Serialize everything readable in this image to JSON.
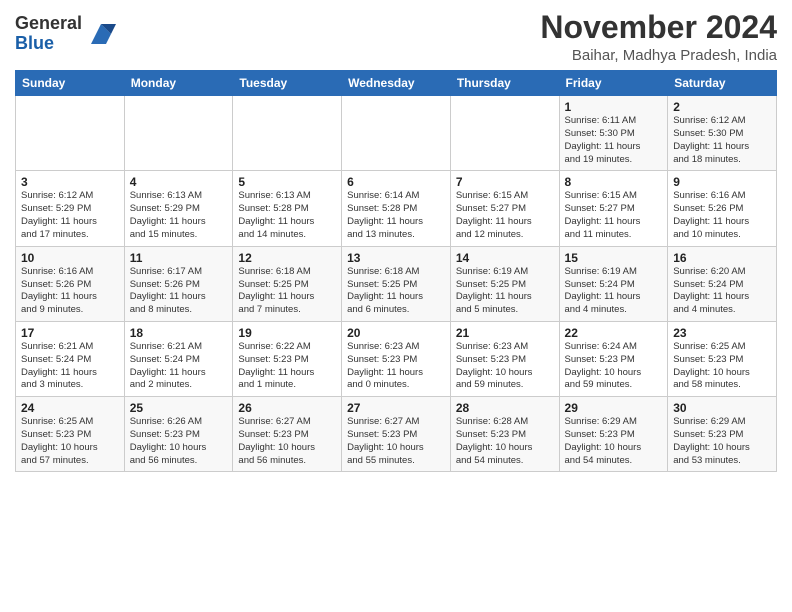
{
  "header": {
    "logo": {
      "line1": "General",
      "line2": "Blue"
    },
    "title": "November 2024",
    "location": "Baihar, Madhya Pradesh, India"
  },
  "calendar": {
    "weekdays": [
      "Sunday",
      "Monday",
      "Tuesday",
      "Wednesday",
      "Thursday",
      "Friday",
      "Saturday"
    ],
    "weeks": [
      [
        {
          "day": "",
          "detail": ""
        },
        {
          "day": "",
          "detail": ""
        },
        {
          "day": "",
          "detail": ""
        },
        {
          "day": "",
          "detail": ""
        },
        {
          "day": "",
          "detail": ""
        },
        {
          "day": "1",
          "detail": "Sunrise: 6:11 AM\nSunset: 5:30 PM\nDaylight: 11 hours\nand 19 minutes."
        },
        {
          "day": "2",
          "detail": "Sunrise: 6:12 AM\nSunset: 5:30 PM\nDaylight: 11 hours\nand 18 minutes."
        }
      ],
      [
        {
          "day": "3",
          "detail": "Sunrise: 6:12 AM\nSunset: 5:29 PM\nDaylight: 11 hours\nand 17 minutes."
        },
        {
          "day": "4",
          "detail": "Sunrise: 6:13 AM\nSunset: 5:29 PM\nDaylight: 11 hours\nand 15 minutes."
        },
        {
          "day": "5",
          "detail": "Sunrise: 6:13 AM\nSunset: 5:28 PM\nDaylight: 11 hours\nand 14 minutes."
        },
        {
          "day": "6",
          "detail": "Sunrise: 6:14 AM\nSunset: 5:28 PM\nDaylight: 11 hours\nand 13 minutes."
        },
        {
          "day": "7",
          "detail": "Sunrise: 6:15 AM\nSunset: 5:27 PM\nDaylight: 11 hours\nand 12 minutes."
        },
        {
          "day": "8",
          "detail": "Sunrise: 6:15 AM\nSunset: 5:27 PM\nDaylight: 11 hours\nand 11 minutes."
        },
        {
          "day": "9",
          "detail": "Sunrise: 6:16 AM\nSunset: 5:26 PM\nDaylight: 11 hours\nand 10 minutes."
        }
      ],
      [
        {
          "day": "10",
          "detail": "Sunrise: 6:16 AM\nSunset: 5:26 PM\nDaylight: 11 hours\nand 9 minutes."
        },
        {
          "day": "11",
          "detail": "Sunrise: 6:17 AM\nSunset: 5:26 PM\nDaylight: 11 hours\nand 8 minutes."
        },
        {
          "day": "12",
          "detail": "Sunrise: 6:18 AM\nSunset: 5:25 PM\nDaylight: 11 hours\nand 7 minutes."
        },
        {
          "day": "13",
          "detail": "Sunrise: 6:18 AM\nSunset: 5:25 PM\nDaylight: 11 hours\nand 6 minutes."
        },
        {
          "day": "14",
          "detail": "Sunrise: 6:19 AM\nSunset: 5:25 PM\nDaylight: 11 hours\nand 5 minutes."
        },
        {
          "day": "15",
          "detail": "Sunrise: 6:19 AM\nSunset: 5:24 PM\nDaylight: 11 hours\nand 4 minutes."
        },
        {
          "day": "16",
          "detail": "Sunrise: 6:20 AM\nSunset: 5:24 PM\nDaylight: 11 hours\nand 4 minutes."
        }
      ],
      [
        {
          "day": "17",
          "detail": "Sunrise: 6:21 AM\nSunset: 5:24 PM\nDaylight: 11 hours\nand 3 minutes."
        },
        {
          "day": "18",
          "detail": "Sunrise: 6:21 AM\nSunset: 5:24 PM\nDaylight: 11 hours\nand 2 minutes."
        },
        {
          "day": "19",
          "detail": "Sunrise: 6:22 AM\nSunset: 5:23 PM\nDaylight: 11 hours\nand 1 minute."
        },
        {
          "day": "20",
          "detail": "Sunrise: 6:23 AM\nSunset: 5:23 PM\nDaylight: 11 hours\nand 0 minutes."
        },
        {
          "day": "21",
          "detail": "Sunrise: 6:23 AM\nSunset: 5:23 PM\nDaylight: 10 hours\nand 59 minutes."
        },
        {
          "day": "22",
          "detail": "Sunrise: 6:24 AM\nSunset: 5:23 PM\nDaylight: 10 hours\nand 59 minutes."
        },
        {
          "day": "23",
          "detail": "Sunrise: 6:25 AM\nSunset: 5:23 PM\nDaylight: 10 hours\nand 58 minutes."
        }
      ],
      [
        {
          "day": "24",
          "detail": "Sunrise: 6:25 AM\nSunset: 5:23 PM\nDaylight: 10 hours\nand 57 minutes."
        },
        {
          "day": "25",
          "detail": "Sunrise: 6:26 AM\nSunset: 5:23 PM\nDaylight: 10 hours\nand 56 minutes."
        },
        {
          "day": "26",
          "detail": "Sunrise: 6:27 AM\nSunset: 5:23 PM\nDaylight: 10 hours\nand 56 minutes."
        },
        {
          "day": "27",
          "detail": "Sunrise: 6:27 AM\nSunset: 5:23 PM\nDaylight: 10 hours\nand 55 minutes."
        },
        {
          "day": "28",
          "detail": "Sunrise: 6:28 AM\nSunset: 5:23 PM\nDaylight: 10 hours\nand 54 minutes."
        },
        {
          "day": "29",
          "detail": "Sunrise: 6:29 AM\nSunset: 5:23 PM\nDaylight: 10 hours\nand 54 minutes."
        },
        {
          "day": "30",
          "detail": "Sunrise: 6:29 AM\nSunset: 5:23 PM\nDaylight: 10 hours\nand 53 minutes."
        }
      ]
    ]
  }
}
